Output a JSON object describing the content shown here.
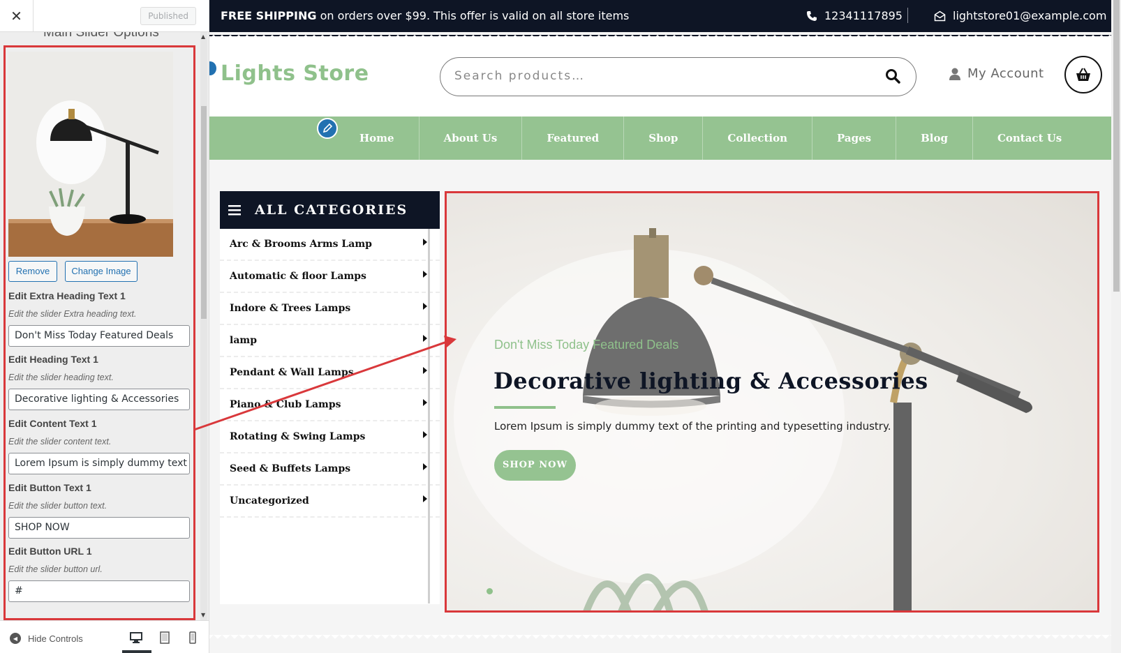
{
  "customizer": {
    "close_label": "✕",
    "published_label": "Published",
    "section_title": "Main Slider Options",
    "remove_label": "Remove",
    "change_image_label": "Change Image",
    "fields": [
      {
        "label": "Edit Extra Heading Text 1",
        "desc": "Edit the slider Extra heading text.",
        "value": "Don't Miss Today Featured Deals"
      },
      {
        "label": "Edit Heading Text 1",
        "desc": "Edit the slider heading text.",
        "value": "Decorative lighting & Accessories"
      },
      {
        "label": "Edit Content Text 1",
        "desc": "Edit the slider content text.",
        "value": "Lorem Ipsum is simply dummy text of the printing and typesetting industry."
      },
      {
        "label": "Edit Button Text 1",
        "desc": "Edit the slider button text.",
        "value": "SHOP NOW"
      },
      {
        "label": "Edit Button URL 1",
        "desc": "Edit the slider button url.",
        "value": "#"
      }
    ],
    "hide_controls_label": "Hide Controls"
  },
  "topbar": {
    "shipping_bold": "FREE SHIPPING",
    "shipping_text": " on orders over $99. This offer is valid on all store items",
    "phone": "12341117895",
    "email": "lightstore01@example.com"
  },
  "header": {
    "logo": "Lights Store",
    "search_placeholder": "Search products…",
    "account_label": "My Account"
  },
  "nav": {
    "items": [
      "Home",
      "About Us",
      "Featured",
      "Shop",
      "Collection",
      "Pages",
      "Blog",
      "Contact Us"
    ]
  },
  "categories": {
    "title": "ALL CATEGORIES",
    "items": [
      "Arc & Brooms Arms Lamp",
      "Automatic & floor Lamps",
      "Indore & Trees Lamps",
      "lamp",
      "Pendant & Wall Lamps",
      "Piano & Club Lamps",
      "Rotating & Swing Lamps",
      "Seed & Buffets Lamps",
      "Uncategorized"
    ]
  },
  "slider": {
    "extra_heading": "Don't Miss Today Featured Deals",
    "heading": "Decorative lighting & Accessories",
    "content": "Lorem Ipsum is simply dummy text of the printing and typesetting industry.",
    "button": "SHOP NOW"
  },
  "colors": {
    "accent_green": "#95c391",
    "dark_navy": "#0e1525",
    "highlight_red": "#d9383b",
    "wp_blue": "#2271b1"
  }
}
